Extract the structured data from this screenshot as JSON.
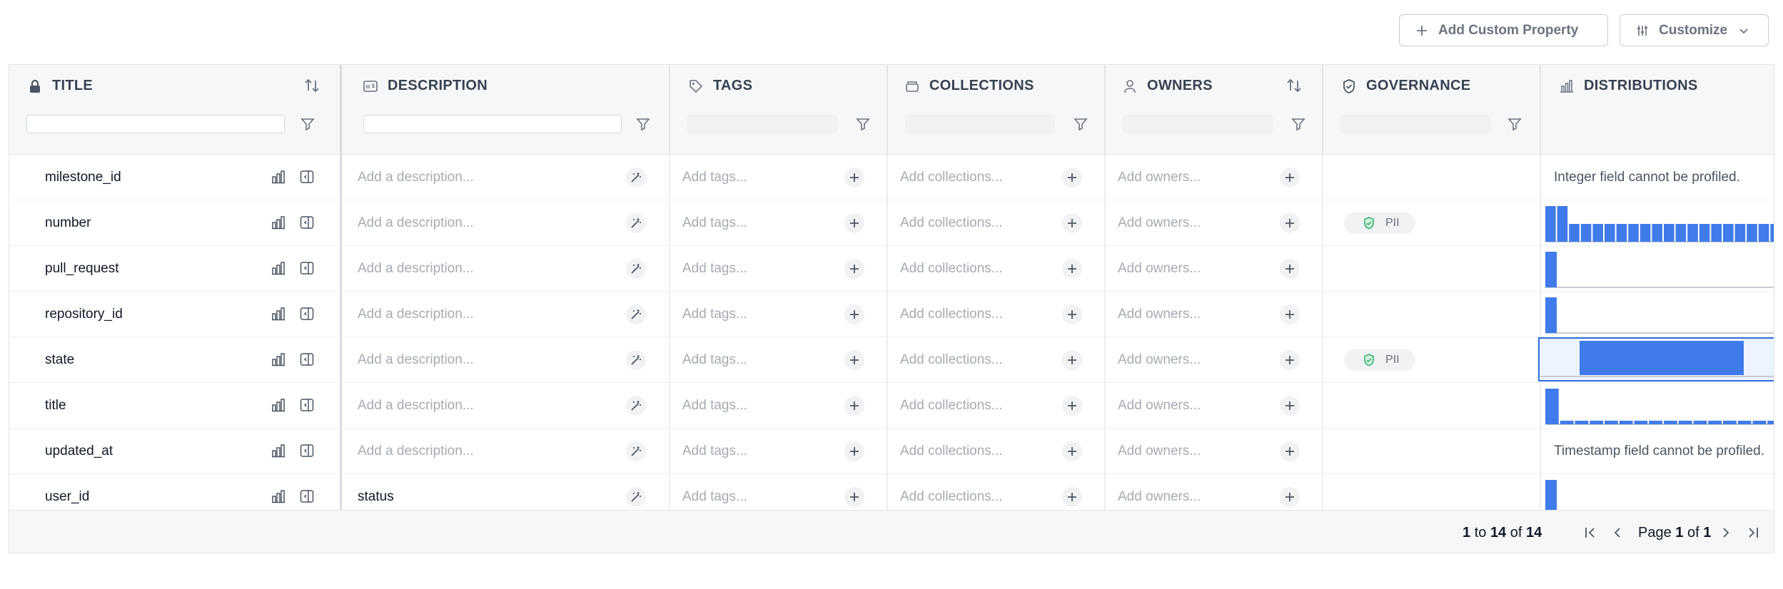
{
  "toolbar": {
    "add_custom_property_label": "Add Custom Property",
    "customize_label": "Customize"
  },
  "columns": [
    {
      "key": "title",
      "label": "TITLE",
      "icon": "lock-icon"
    },
    {
      "key": "description",
      "label": "DESCRIPTION",
      "icon": "text-icon"
    },
    {
      "key": "tags",
      "label": "TAGS",
      "icon": "tag-icon"
    },
    {
      "key": "collections",
      "label": "COLLECTIONS",
      "icon": "folder-icon"
    },
    {
      "key": "owners",
      "label": "OWNERS",
      "icon": "user-icon"
    },
    {
      "key": "governance",
      "label": "GOVERNANCE",
      "icon": "shield-icon"
    },
    {
      "key": "distributions",
      "label": "DISTRIBUTIONS",
      "icon": "bar-chart-icon"
    }
  ],
  "placeholders": {
    "description": "Add a description...",
    "tags": "Add tags...",
    "collections": "Add collections...",
    "owners": "Add owners..."
  },
  "rows": [
    {
      "title": "milestone_id",
      "description": "",
      "governance": "",
      "distribution_note": "Integer field cannot be profiled.",
      "histogram": []
    },
    {
      "title": "number",
      "description": "",
      "governance": "PII",
      "distribution_note": "",
      "histogram": [
        10,
        10,
        5,
        5,
        5,
        5,
        5,
        5,
        5,
        5,
        5,
        5,
        5,
        5,
        5,
        5,
        5,
        5,
        5,
        5
      ]
    },
    {
      "title": "pull_request",
      "description": "",
      "governance": "",
      "distribution_note": "",
      "histogram": [
        1
      ]
    },
    {
      "title": "repository_id",
      "description": "",
      "governance": "",
      "distribution_note": "",
      "histogram": [
        1
      ]
    },
    {
      "title": "state",
      "description": "",
      "governance": "PII",
      "distribution_note": "",
      "histogram": [
        1
      ],
      "selected": true
    },
    {
      "title": "title",
      "description": "",
      "governance": "",
      "distribution_note": "",
      "histogram": [
        10,
        1,
        1,
        1,
        1,
        1,
        1,
        1,
        1,
        1,
        1,
        1,
        1,
        1,
        1,
        1
      ]
    },
    {
      "title": "updated_at",
      "description": "",
      "governance": "",
      "distribution_note": "Timestamp field cannot be profiled.",
      "histogram": []
    },
    {
      "title": "user_id",
      "description": "status",
      "governance": "",
      "distribution_note": "",
      "histogram": [
        1
      ]
    }
  ],
  "pagination": {
    "from": "1",
    "to_word": "to",
    "to": "14",
    "of_word": "of",
    "total": "14",
    "page_word": "Page",
    "page": "1",
    "page_of_word": "of",
    "pages": "1"
  },
  "colors": {
    "accent": "#3f7bea",
    "selected_border": "#2f6fe4",
    "pii_shield": "#34b36b"
  }
}
